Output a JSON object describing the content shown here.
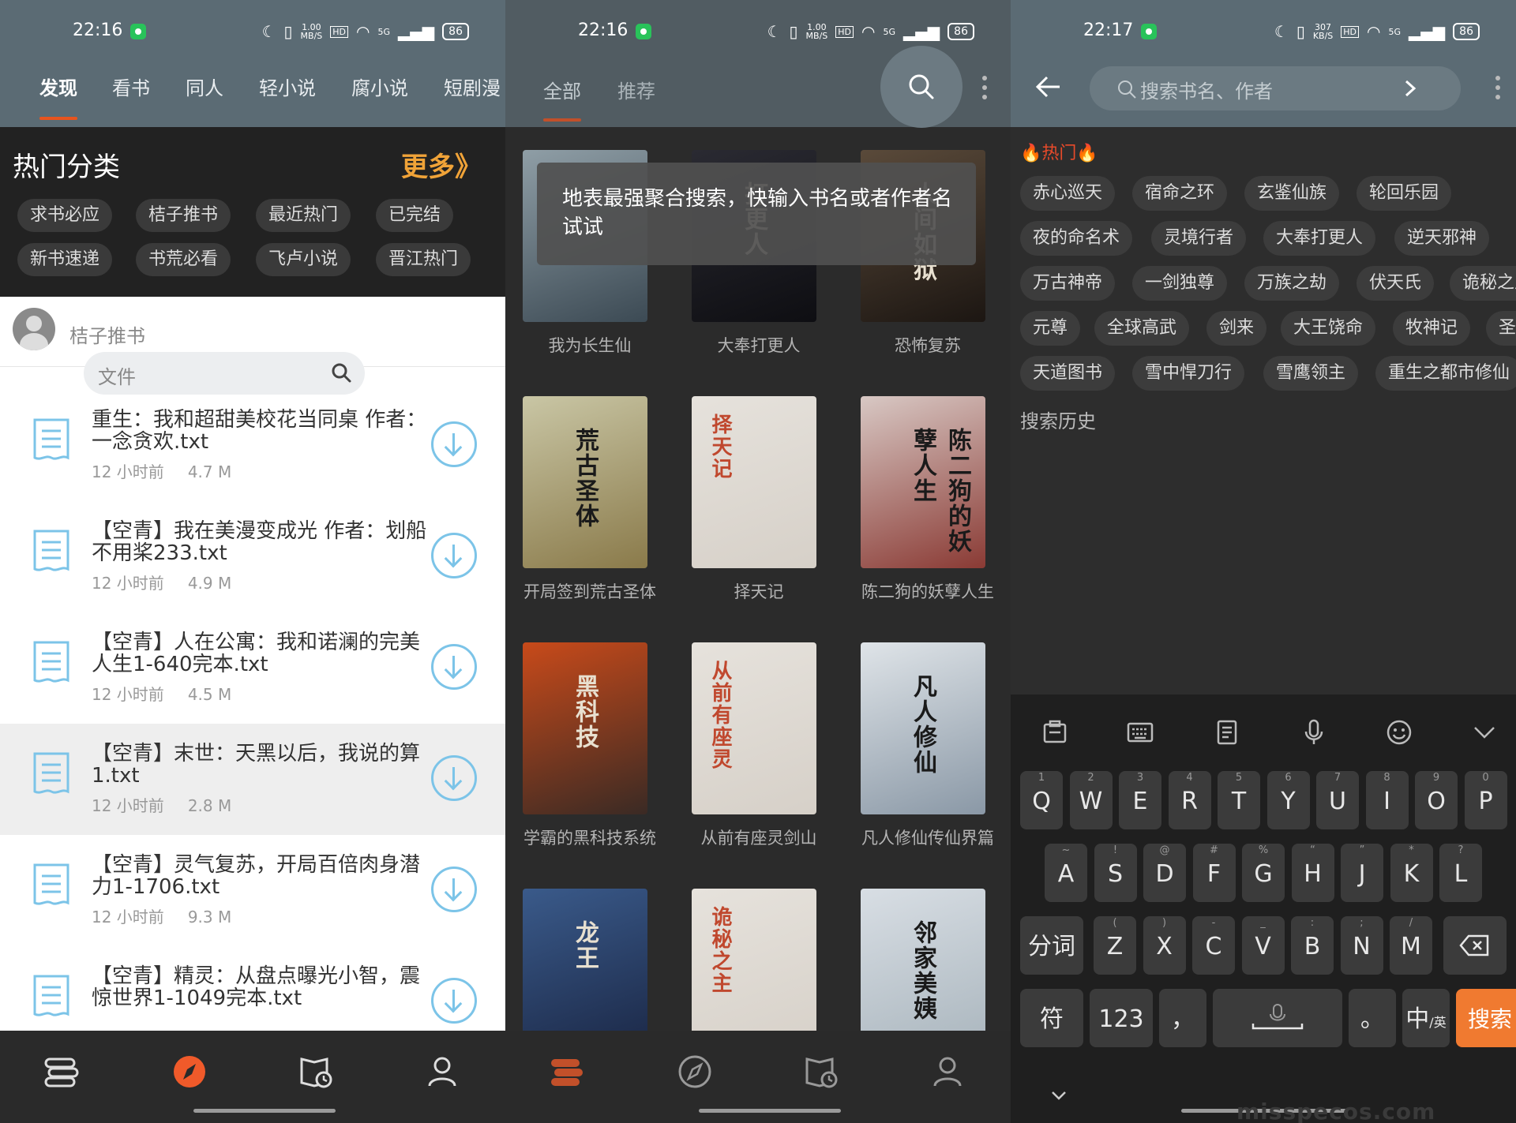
{
  "status": {
    "time1": "22:16",
    "time2": "22:16",
    "time3": "22:17",
    "speed1": "1.00\nMB/S",
    "speed2": "1.00\nMB/S",
    "speed3": "307\nKB/S",
    "hd": "HD",
    "net": "5G",
    "battery": "86"
  },
  "p1": {
    "tabs": [
      "发现",
      "看书",
      "同人",
      "轻小说",
      "腐小说",
      "短剧漫"
    ],
    "hot_title": "热门分类",
    "more": "更多》",
    "chips": [
      "求书必应",
      "桔子推书",
      "最近热门",
      "已完结",
      "新书速递",
      "书荒必看",
      "飞卢小说",
      "晋江热门"
    ],
    "user": "桔子推书",
    "search_placeholder": "文件",
    "files": [
      {
        "title": "重生：我和超甜美校花当同桌 作者：一念贪欢.txt",
        "time": "12 小时前",
        "size": "4.7 M"
      },
      {
        "title": "【空青】我在美漫变成光 作者：划船不用桨233.txt",
        "time": "12 小时前",
        "size": "4.9 M"
      },
      {
        "title": "【空青】人在公寓：我和诺澜的完美人生1-640完本.txt",
        "time": "12 小时前",
        "size": "4.5 M"
      },
      {
        "title": "【空青】末世：天黑以后，我说的算1.txt",
        "time": "12 小时前",
        "size": "2.8 M"
      },
      {
        "title": "【空青】灵气复苏，开局百倍肉身潜力1-1706.txt",
        "time": "12 小时前",
        "size": "9.3 M"
      },
      {
        "title": "【空青】精灵：从盘点曝光小智，震惊世界1-1049完本.txt",
        "time": "",
        "size": ""
      }
    ]
  },
  "p2": {
    "tabs": [
      "全部",
      "推荐"
    ],
    "toast": "地表最强聚合搜索，快输入书名或者作者名试试",
    "books": [
      {
        "title": "我为长生仙",
        "cover_text": "",
        "c1": "#8f9ea6",
        "c2": "#3c4a54"
      },
      {
        "title": "大奉打更人",
        "cover_text": "打更人",
        "c1": "#2a2a32",
        "c2": "#0e0e12"
      },
      {
        "title": "恐怖复苏",
        "cover_text": "人间如狱",
        "c1": "#5a4a3a",
        "c2": "#1c1612"
      },
      {
        "title": "开局签到荒古圣体",
        "cover_text": "荒古圣体",
        "c1": "#c9c6a5",
        "c2": "#8a7a4a"
      },
      {
        "title": "择天记",
        "cover_text": "择天记",
        "c1": "#e6e2dc",
        "c2": "#d6d0c8"
      },
      {
        "title": "陈二狗的妖孽人生",
        "cover_text": "陈二狗的妖孽人生",
        "c1": "#d8c8c4",
        "c2": "#8a3a34"
      },
      {
        "title": "学霸的黑科技系统",
        "cover_text": "黑科技",
        "c1": "#c84a1a",
        "c2": "#3a2a24"
      },
      {
        "title": "从前有座灵剑山",
        "cover_text": "从前有座灵",
        "c1": "#e6e2dc",
        "c2": "#d6d0c8"
      },
      {
        "title": "凡人修仙传仙界篇",
        "cover_text": "凡人修仙",
        "c1": "#dfe4e8",
        "c2": "#8a98a6"
      },
      {
        "title": "",
        "cover_text": "龙王",
        "c1": "#3a5a8a",
        "c2": "#1a2644"
      },
      {
        "title": "",
        "cover_text": "诡秘之主",
        "c1": "#e6e2dc",
        "c2": "#d6d0c8"
      },
      {
        "title": "",
        "cover_text": "邻家美姨",
        "c1": "#d8dee4",
        "c2": "#a8b4bc"
      }
    ]
  },
  "p3": {
    "search_placeholder": "搜索书名、作者",
    "hot_label": "🔥热门🔥",
    "hot_rows": [
      [
        "赤心巡天",
        "宿命之环",
        "玄鉴仙族",
        "轮回乐园"
      ],
      [
        "夜的命名术",
        "灵境行者",
        "大奉打更人",
        "逆天邪神"
      ],
      [
        "万古神帝",
        "一剑独尊",
        "万族之劫",
        "伏天氏",
        "诡秘之主"
      ],
      [
        "元尊",
        "全球高武",
        "剑来",
        "大王饶命",
        "牧神记",
        "圣墟"
      ],
      [
        "天道图书",
        "雪中悍刀行",
        "雪鹰领主",
        "重生之都市修仙"
      ]
    ],
    "history": "搜索历史",
    "keys_row1": [
      [
        "Q",
        "1"
      ],
      [
        "W",
        "2"
      ],
      [
        "E",
        "3"
      ],
      [
        "R",
        "4"
      ],
      [
        "T",
        "5"
      ],
      [
        "Y",
        "6"
      ],
      [
        "U",
        "7"
      ],
      [
        "I",
        "8"
      ],
      [
        "O",
        "9"
      ],
      [
        "P",
        "0"
      ]
    ],
    "keys_row2": [
      [
        "A",
        "~"
      ],
      [
        "S",
        "!"
      ],
      [
        "D",
        "@"
      ],
      [
        "F",
        "#"
      ],
      [
        "G",
        "%"
      ],
      [
        "H",
        "“"
      ],
      [
        "J",
        "”"
      ],
      [
        "K",
        "*"
      ],
      [
        "L",
        "?"
      ]
    ],
    "keys_row3": [
      [
        "Z",
        "("
      ],
      [
        "X",
        ")"
      ],
      [
        "C",
        "-"
      ],
      [
        "V",
        "_"
      ],
      [
        "B",
        ":"
      ],
      [
        "N",
        ";"
      ],
      [
        "M",
        "/"
      ]
    ],
    "key_fenci": "分词",
    "key_fu": "符",
    "key_123": "123",
    "key_comma": "，",
    "key_period": "。",
    "key_zh": "中",
    "key_en": "/英",
    "key_search": "搜索",
    "watermark": "misspecos.com"
  }
}
